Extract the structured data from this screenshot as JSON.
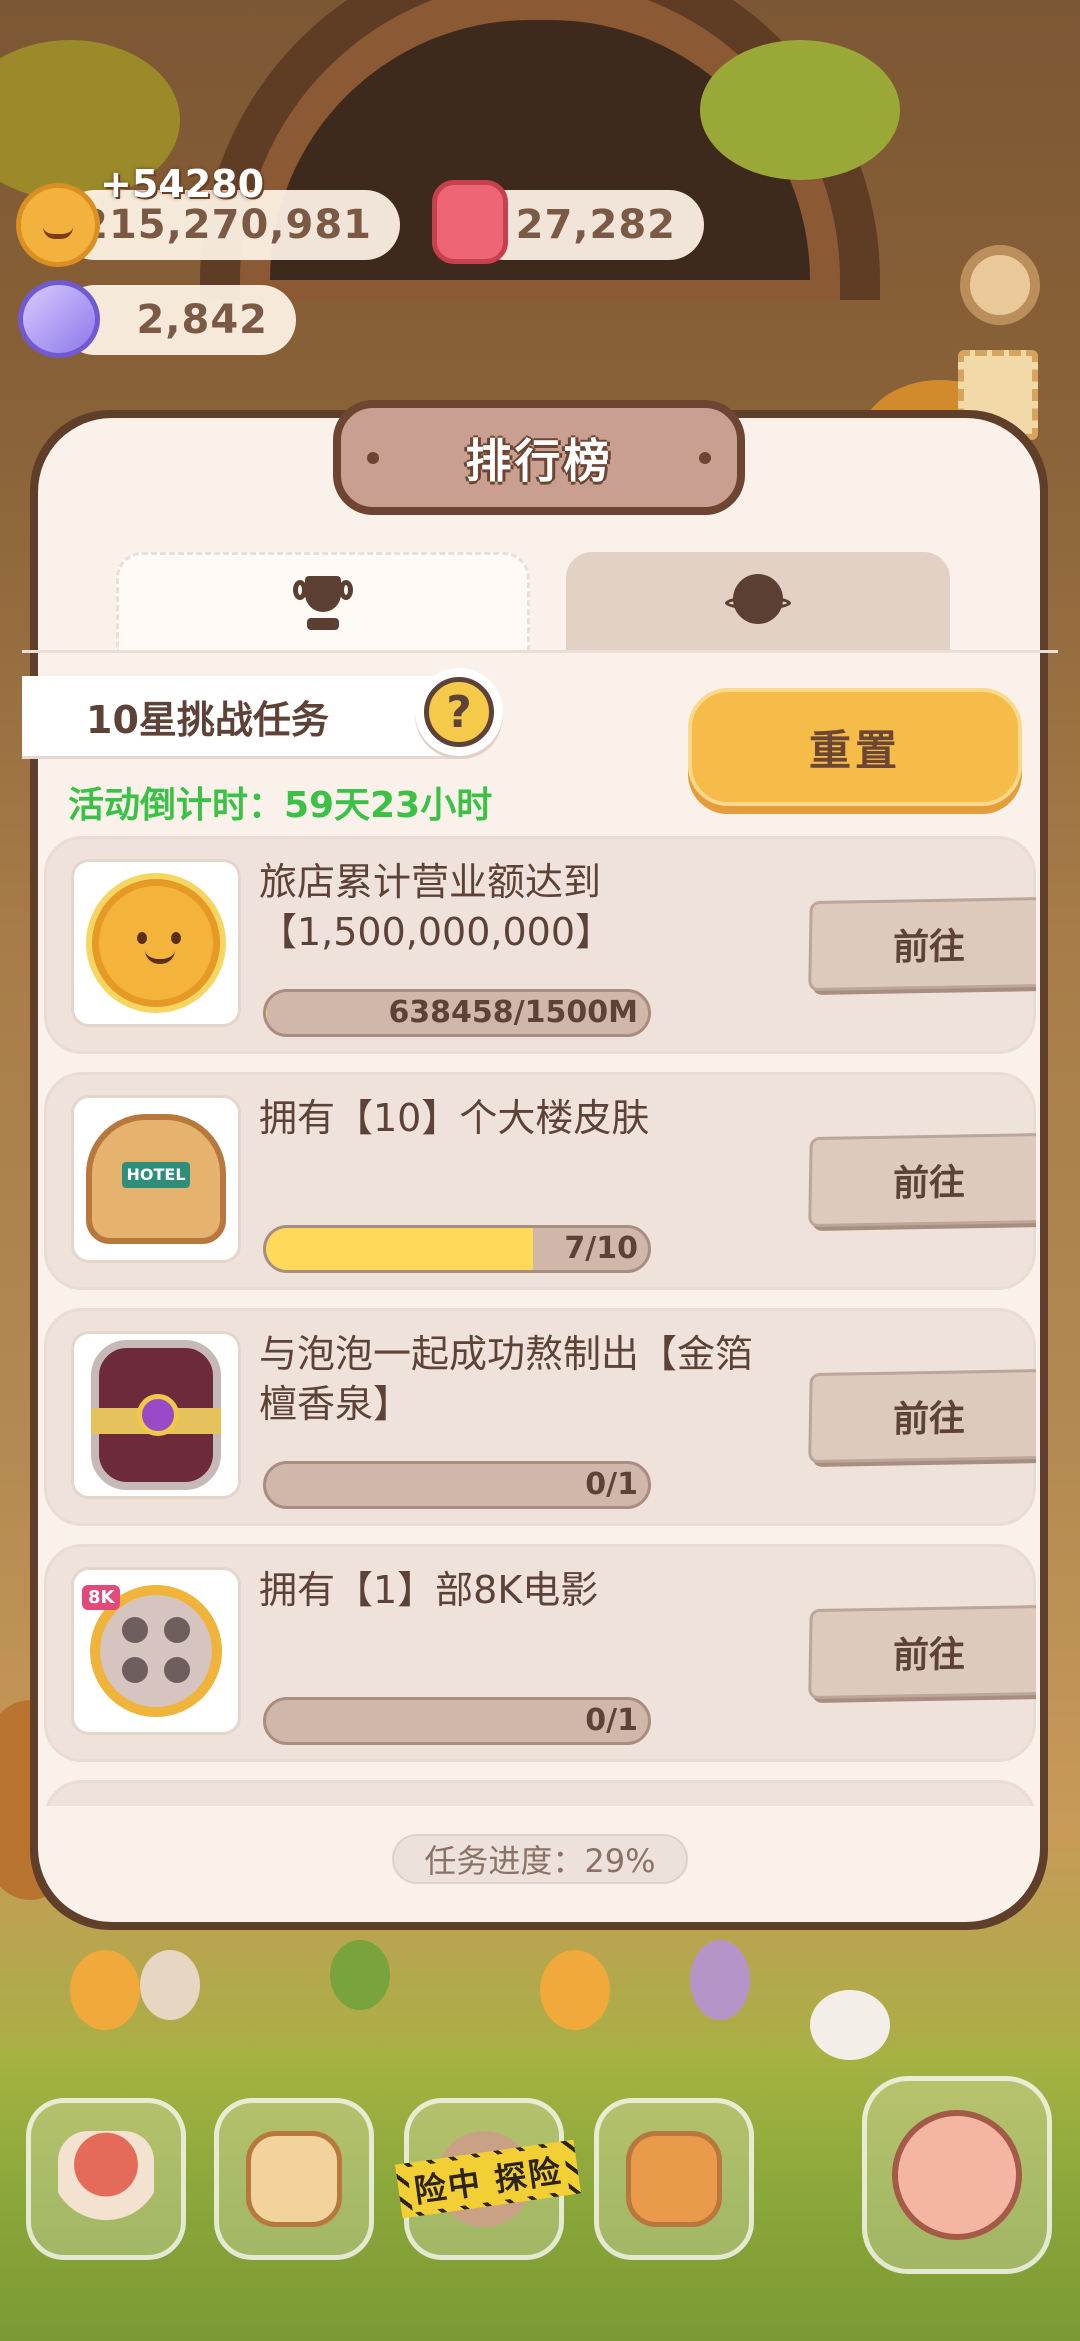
{
  "currency": {
    "gold_delta": "+54280",
    "gold": "215,270,981",
    "candle": "27,282",
    "gem": "2,842"
  },
  "panel": {
    "title": "排行榜",
    "tabs": [
      {
        "icon": "trophy-icon",
        "active": true
      },
      {
        "icon": "planet-icon",
        "active": false
      }
    ],
    "challenge_label": "10星挑战任务",
    "help_symbol": "?",
    "reset_label": "重置",
    "countdown": "活动倒计时：59天23小时",
    "tasks": [
      {
        "title": "旅店累计营业额达到【1,500,000,000】",
        "progress_text": "638458/1500M",
        "progress": 0.0004,
        "go_label": "前往",
        "icon": "cookie-coin-icon"
      },
      {
        "title": "拥有【10】个大楼皮肤",
        "progress_text": "7/10",
        "progress": 0.7,
        "go_label": "前往",
        "icon": "hotel-skin-icon"
      },
      {
        "title": "与泡泡一起成功熬制出【金箔檀香泉】",
        "progress_text": "0/1",
        "progress": 0.0,
        "go_label": "前往",
        "icon": "potion-jar-icon"
      },
      {
        "title": "拥有【1】部8K电影",
        "progress_text": "0/1",
        "progress": 0.0,
        "go_label": "前往",
        "icon": "film-reel-icon",
        "badge": "8K"
      }
    ],
    "overall_progress": "任务进度：29%"
  },
  "nav": {
    "tape_text": "险中 探险",
    "items": [
      "mushroom-house-icon",
      "notebook-icon",
      "adventure-icon",
      "shop-icon",
      "fish-character-icon"
    ]
  },
  "colors": {
    "accent": "#f6bc49",
    "countdown": "#3cc147",
    "progress_fill": "#ffd95a",
    "panel_border": "#5f3f2a"
  }
}
